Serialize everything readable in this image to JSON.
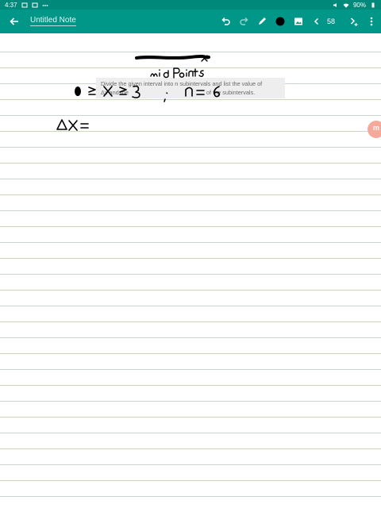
{
  "status_bar": {
    "time": "4:37",
    "battery": "90%"
  },
  "toolbar": {
    "note_title": "Untitled Note",
    "page_number": "58",
    "icons": [
      "back-arrow-icon",
      "undo-icon",
      "redo-icon",
      "pen-icon",
      "color-swatch-icon",
      "image-icon",
      "prev-page-icon",
      "next-page-add-icon",
      "more-icon"
    ],
    "accent_color": "#009688",
    "pen_color": "#000000"
  },
  "question": {
    "line1": "Divide the given interval into n subintervals and list the value of",
    "line2_prefix": "Δx and the",
    "line2_suffix": "of the subintervals."
  },
  "handwriting": {
    "correction": "mid Points",
    "interval": "0 ≤ x ≤ 3",
    "n_value": "n = 6",
    "delta": "Δx ="
  },
  "side_tab": {
    "label": "m"
  }
}
